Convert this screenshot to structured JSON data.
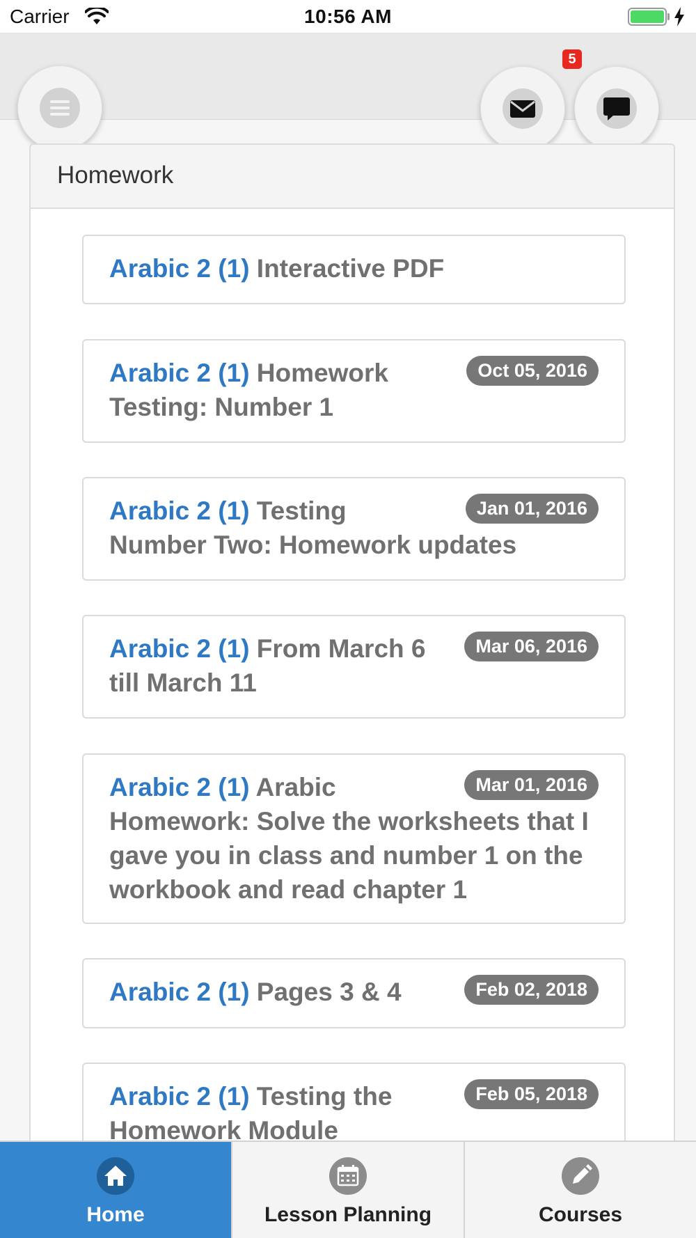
{
  "status_bar": {
    "carrier": "Carrier",
    "time": "10:56 AM",
    "battery_color": "#4cd964"
  },
  "header": {
    "menu_icon": "hamburger-menu-icon",
    "mail_icon": "envelope-icon",
    "chat_icon": "chat-bubble-icon",
    "notification_count": "5",
    "badge_color": "#e8271f"
  },
  "panel": {
    "title": "Homework",
    "items": [
      {
        "course": "Arabic 2 (1)",
        "title": "Interactive PDF",
        "date": ""
      },
      {
        "course": "Arabic 2 (1)",
        "title": "Homework Testing: Number 1",
        "date": "Oct 05, 2016"
      },
      {
        "course": "Arabic 2 (1)",
        "title": "Testing Number Two: Homework updates",
        "date": "Jan 01, 2016"
      },
      {
        "course": "Arabic 2 (1)",
        "title": "From March 6 till March 11",
        "date": "Mar 06, 2016"
      },
      {
        "course": "Arabic 2 (1)",
        "title": "Arabic Homework: Solve the worksheets that I gave you in class and number 1 on the workbook and read chapter 1",
        "date": "Mar 01, 2016"
      },
      {
        "course": "Arabic 2 (1)",
        "title": "Pages 3 & 4",
        "date": "Feb 02, 2018"
      },
      {
        "course": "Arabic 2 (1)",
        "title": "Testing the Homework Module",
        "date": "Feb 05, 2018"
      }
    ]
  },
  "tabs": [
    {
      "label": "Home",
      "icon": "home-icon",
      "active": true
    },
    {
      "label": "Lesson Planning",
      "icon": "calendar-icon",
      "active": false
    },
    {
      "label": "Courses",
      "icon": "pencil-icon",
      "active": false
    }
  ],
  "colors": {
    "course_link": "#2f79c4",
    "active_tab": "#3487cf",
    "date_badge": "#777777"
  }
}
